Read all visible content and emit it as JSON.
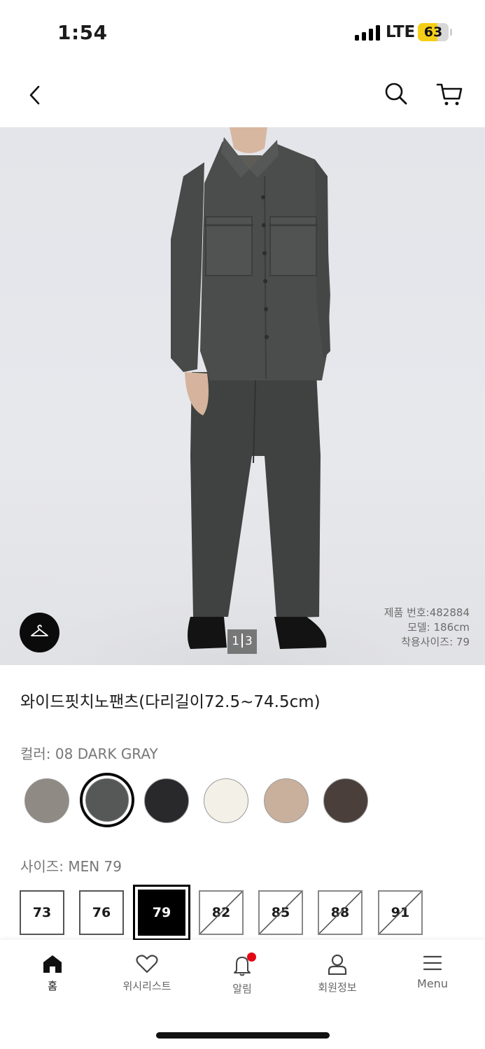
{
  "status_bar": {
    "time": "1:54",
    "network": "LTE",
    "battery": "63",
    "battery_level": 0.63
  },
  "header": {
    "back_icon": "chevron-left-icon",
    "search_icon": "search-icon",
    "cart_icon": "cart-icon"
  },
  "image": {
    "counter_current": "1",
    "counter_total": "3",
    "model_info": [
      "제품 번호:482884",
      "모델: 186cm",
      "착용사이즈: 79"
    ],
    "fit_icon": "hanger-icon"
  },
  "product": {
    "title": "와이드핏치노팬츠(다리길이72.5~74.5cm)"
  },
  "color": {
    "label": "컬러:",
    "selected": "08 DARK GRAY",
    "swatches": [
      {
        "hex": "#8f8a84",
        "selected": false
      },
      {
        "hex": "#565857",
        "selected": true
      },
      {
        "hex": "#29282a",
        "selected": false
      },
      {
        "hex": "#f3f1e7",
        "selected": false
      },
      {
        "hex": "#c9b09c",
        "selected": false
      },
      {
        "hex": "#4a3f3b",
        "selected": false
      }
    ]
  },
  "size": {
    "label": "사이즈:",
    "selected": "MEN 79",
    "options": [
      {
        "label": "73",
        "state": "available"
      },
      {
        "label": "76",
        "state": "available"
      },
      {
        "label": "79",
        "state": "selected"
      },
      {
        "label": "82",
        "state": "sold_out"
      },
      {
        "label": "85",
        "state": "sold_out"
      },
      {
        "label": "88",
        "state": "sold_out"
      },
      {
        "label": "91",
        "state": "sold_out"
      }
    ]
  },
  "tabbar": {
    "items": [
      {
        "label": "홈",
        "icon": "home-icon"
      },
      {
        "label": "위시리스트",
        "icon": "heart-icon"
      },
      {
        "label": "알림",
        "icon": "bell-icon"
      },
      {
        "label": "회원정보",
        "icon": "user-icon"
      },
      {
        "label": "Menu",
        "icon": "menu-icon"
      }
    ]
  },
  "colors": {
    "accent": "#e30613",
    "battery": "#f5cf17",
    "text": "#1b1b1b",
    "muted": "#777777"
  }
}
